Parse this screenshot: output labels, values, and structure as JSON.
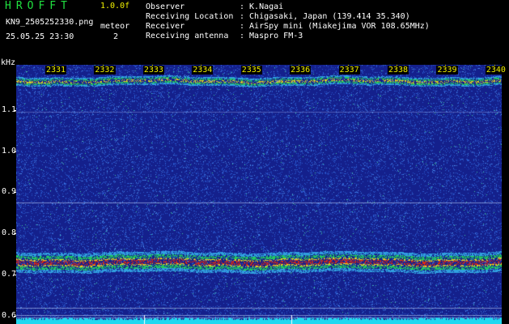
{
  "header": {
    "app_title": "HROFFT",
    "version": "1.0.0f",
    "filename": "KN9_2505252330.png",
    "timestamp": "25.05.25 23:30",
    "mode_label": "meteor",
    "mode_value": "2"
  },
  "info": [
    {
      "key": "Observer",
      "value": ": K.Nagai"
    },
    {
      "key": "Receiving Location",
      "value": ": Chigasaki, Japan (139.414 35.340)"
    },
    {
      "key": "Receiver",
      "value": ": AirSpy mini (Miakejima VOR 108.65MHz)"
    },
    {
      "key": "Receiving antenna",
      "value": ": Maspro FM-3"
    }
  ],
  "y_axis": {
    "unit": "kHz",
    "range": [
      0.58,
      1.21
    ],
    "ticks": [
      {
        "value": 1.1,
        "label": "1.1"
      },
      {
        "value": 1.0,
        "label": "1.0"
      },
      {
        "value": 0.9,
        "label": "0.9"
      },
      {
        "value": 0.8,
        "label": "0.8"
      },
      {
        "value": 0.7,
        "label": "0.7"
      },
      {
        "value": 0.6,
        "label": "0.6"
      }
    ]
  },
  "x_axis": {
    "ticks": [
      "2331",
      "2332",
      "2333",
      "2334",
      "2335",
      "2336",
      "2337",
      "2338",
      "2339",
      "2340"
    ]
  },
  "spectrogram": {
    "bands_khz": [
      1.17,
      0.73
    ],
    "colors": {
      "background": "#14208c",
      "noise": "#2a5ad0",
      "band_core": "#e02810",
      "band_mid": "#e0d020",
      "band_edge": "#20c860",
      "floor": "#20d8f0"
    }
  }
}
